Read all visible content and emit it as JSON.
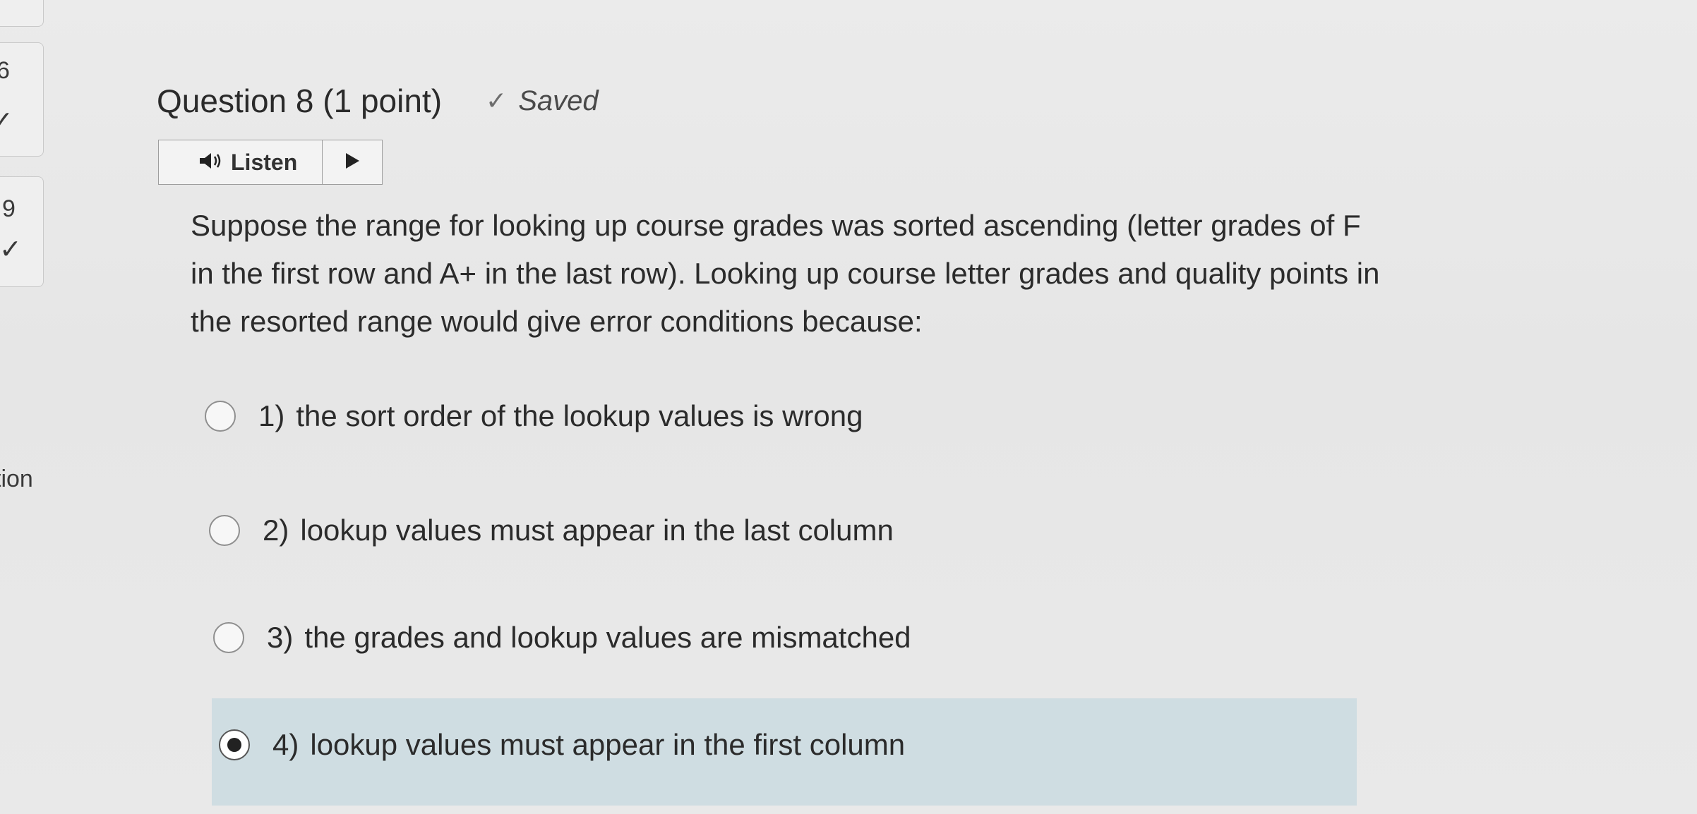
{
  "nav": {
    "items": [
      {
        "number": "6",
        "status": "✓"
      },
      {
        "number": "9",
        "status": "✓"
      }
    ],
    "side_label": "tion"
  },
  "question": {
    "title": "Question 8",
    "points": "(1 point)",
    "saved_label": "Saved",
    "text": "Suppose the range for looking up course grades was sorted ascending (letter grades of F in the first row and A+ in the last row). Looking up course letter grades and quality points in the resorted range would give error conditions because:"
  },
  "listen": {
    "label": "Listen"
  },
  "options": [
    {
      "number": "1)",
      "label": "the sort order of the lookup values is wrong",
      "selected": false
    },
    {
      "number": "2)",
      "label": "lookup values must appear in the last column",
      "selected": false
    },
    {
      "number": "3)",
      "label": "the grades and lookup values are mismatched",
      "selected": false
    },
    {
      "number": "4)",
      "label": "lookup values must appear in the first column",
      "selected": true
    }
  ],
  "colors": {
    "selected_option_bg": "#cfdde2",
    "page_bg": "#e8e8e8"
  },
  "icons": {
    "speaker": "speaker-icon",
    "play": "play-icon",
    "saved": "checkmark-icon"
  }
}
